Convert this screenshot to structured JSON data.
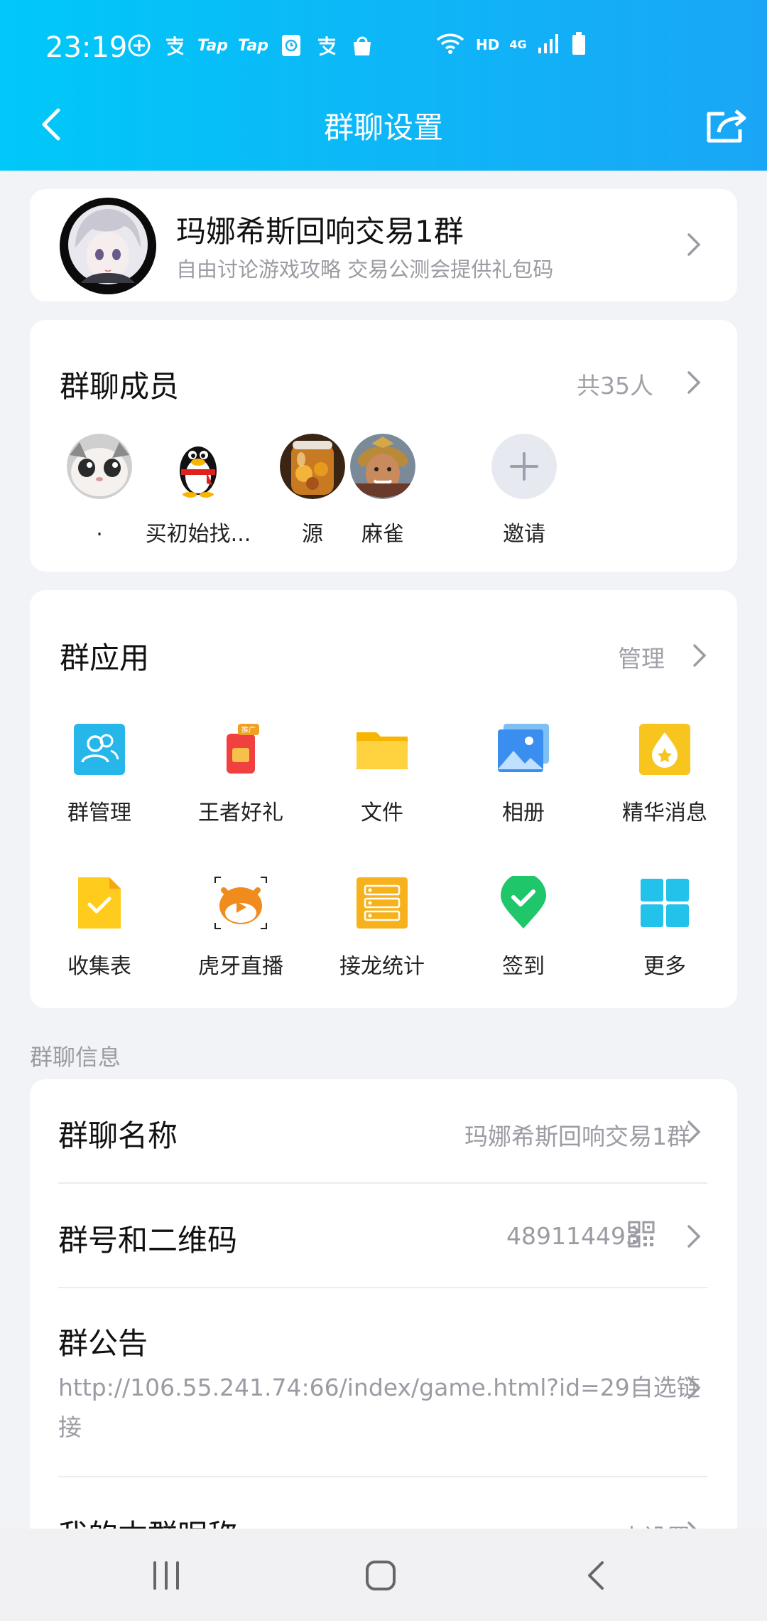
{
  "status_bar": {
    "time": "23:19",
    "left_icons": [
      "plus-circle-icon",
      "alipay-icon",
      "tap-icon",
      "tap-icon",
      "clock-app-icon",
      "alipay-icon",
      "shopping-bag-icon"
    ],
    "tap_label": "Tap",
    "hd_label": "HD",
    "network_label": "4G"
  },
  "nav": {
    "title": "群聊设置"
  },
  "group": {
    "name": "玛娜希斯回响交易1群",
    "description": "自由讨论游戏攻略 交易公测会提供礼包码"
  },
  "members": {
    "title": "群聊成员",
    "count_label": "共35人",
    "items": [
      {
        "name": ".",
        "avatar": "cat-avatar"
      },
      {
        "name": "买初始找...",
        "avatar": "penguin-avatar"
      },
      {
        "name": "源",
        "avatar": "jar-avatar"
      },
      {
        "name": "麻雀",
        "avatar": "warrior-avatar"
      },
      {
        "name": "邀请",
        "avatar": "invite-plus-icon"
      }
    ]
  },
  "apps": {
    "title": "群应用",
    "manage_label": "管理",
    "items": [
      {
        "label": "群管理",
        "icon": "group-manage-icon"
      },
      {
        "label": "王者好礼",
        "icon": "gift-icon"
      },
      {
        "label": "文件",
        "icon": "folder-icon"
      },
      {
        "label": "相册",
        "icon": "album-icon"
      },
      {
        "label": "精华消息",
        "icon": "essence-icon"
      },
      {
        "label": "收集表",
        "icon": "form-icon"
      },
      {
        "label": "虎牙直播",
        "icon": "huya-icon"
      },
      {
        "label": "接龙统计",
        "icon": "relay-icon"
      },
      {
        "label": "签到",
        "icon": "checkin-icon"
      },
      {
        "label": "更多",
        "icon": "more-grid-icon"
      }
    ],
    "gift_badge": "推广"
  },
  "info": {
    "section_label": "群聊信息",
    "name_row": {
      "title": "群聊名称",
      "value": "玛娜希斯回响交易1群"
    },
    "number_row": {
      "title": "群号和二维码",
      "value": "489114493"
    },
    "notice_row": {
      "title": "群公告",
      "value": "http://106.55.241.74:66/index/game.html?id=29自选链接"
    },
    "nickname_row": {
      "title": "我的本群昵称",
      "value": "未设置"
    }
  },
  "colors": {
    "header_start": "#00c8f8",
    "header_end": "#1aa6f6",
    "background": "#f2f3f7",
    "secondary_text": "#9b9ba3"
  }
}
